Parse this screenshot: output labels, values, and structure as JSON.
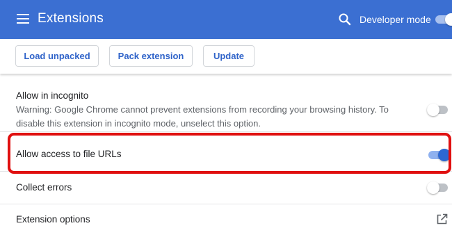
{
  "header": {
    "title": "Extensions",
    "developer_mode_label": "Developer mode",
    "developer_mode_on": true,
    "accent_color": "#3b6fd2"
  },
  "toolbar": {
    "buttons": [
      {
        "label": "Load unpacked"
      },
      {
        "label": "Pack extension"
      },
      {
        "label": "Update"
      }
    ]
  },
  "settings": {
    "incognito": {
      "label": "Allow in incognito",
      "description": "Warning: Google Chrome cannot prevent extensions from recording your browsing history. To disable this extension in incognito mode, unselect this option.",
      "enabled": false
    },
    "file_urls": {
      "label": "Allow access to file URLs",
      "enabled": true
    },
    "collect_errors": {
      "label": "Collect errors",
      "enabled": false
    },
    "extension_options": {
      "label": "Extension options",
      "icon": "open-in-new-icon"
    }
  },
  "highlight_color": "#e01010"
}
